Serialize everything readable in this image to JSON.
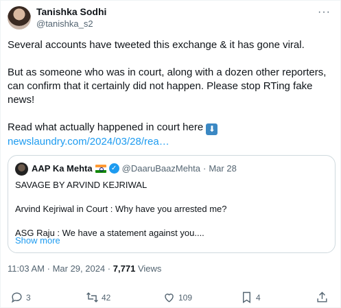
{
  "author": {
    "name": "Tanishka Sodhi",
    "handle": "@tanishka_s2"
  },
  "more_icon": "more-horizontal-icon",
  "tweet": {
    "p1": "Several accounts have tweeted this exchange & it has gone viral.",
    "p2": "But as someone who was in court, along with a dozen other reporters, can confirm that it certainly did not happen. Please stop RTing fake news!",
    "p3": "Read what actually happened in court here",
    "emoji": "⬇",
    "link": "newslaundry.com/2024/03/28/rea…"
  },
  "quote": {
    "name": "AAP Ka Mehta",
    "handle": "@DaaruBaazMehta",
    "separator": "·",
    "date": "Mar 28",
    "line1": "SAVAGE BY ARVIND KEJRIWAL",
    "line2": "Arvind Kejriwal in Court : Why have you arrested me?",
    "line3": "ASG  Raju : We have a statement against you....",
    "show_more": "Show more"
  },
  "meta": {
    "time": "11:03 AM",
    "sep": "·",
    "date": "Mar 29, 2024",
    "views_count": "7,771",
    "views_label": "Views"
  },
  "actions": {
    "replies": "3",
    "reposts": "42",
    "likes": "109",
    "bookmarks": "4"
  },
  "colors": {
    "accent": "#1d9bf0",
    "text": "#0f1419",
    "muted": "#536471",
    "border": "#cfd9de"
  }
}
